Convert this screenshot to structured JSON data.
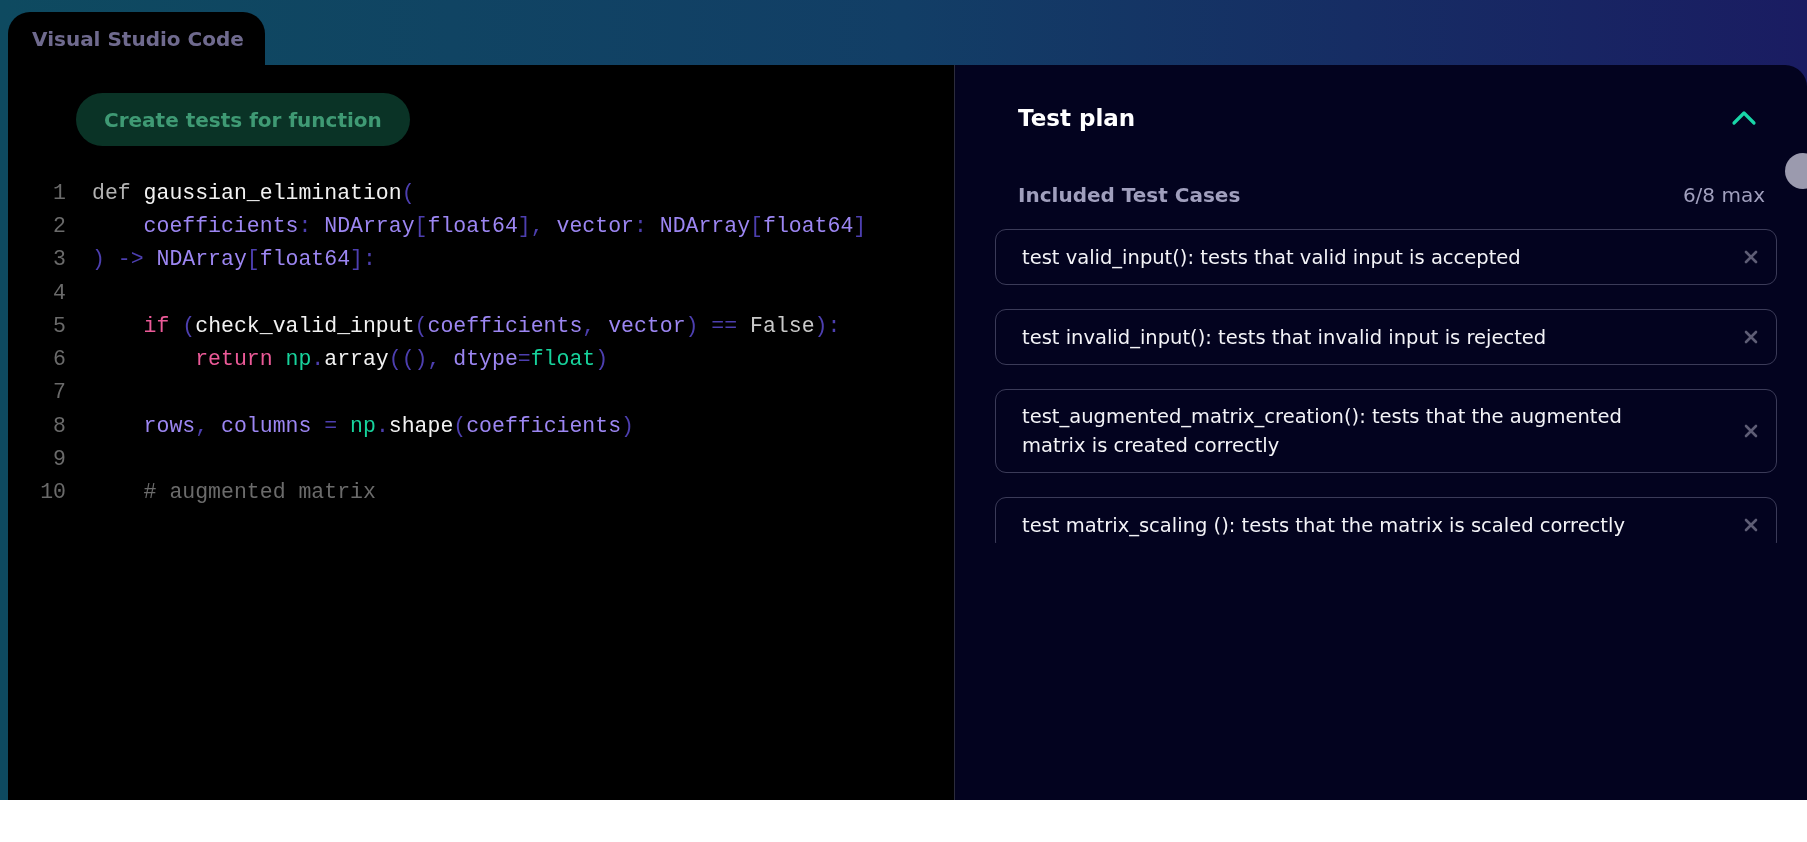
{
  "window": {
    "title": "Visual Studio Code"
  },
  "editor": {
    "action_button": "Create tests for function",
    "lines": [
      {
        "number": "1",
        "tokens": [
          {
            "text": "def ",
            "kind": "def"
          },
          {
            "text": "gaussian_elimination",
            "kind": "fn"
          },
          {
            "text": "(",
            "kind": "punct"
          }
        ]
      },
      {
        "number": "2",
        "tokens": [
          {
            "text": "    coefficients",
            "kind": "ident"
          },
          {
            "text": ": ",
            "kind": "punct"
          },
          {
            "text": "NDArray",
            "kind": "ident"
          },
          {
            "text": "[",
            "kind": "punct"
          },
          {
            "text": "float64",
            "kind": "ident"
          },
          {
            "text": "], ",
            "kind": "punct"
          },
          {
            "text": "vector",
            "kind": "ident"
          },
          {
            "text": ": ",
            "kind": "punct"
          },
          {
            "text": "NDArray",
            "kind": "ident"
          },
          {
            "text": "[",
            "kind": "punct"
          },
          {
            "text": "float64",
            "kind": "ident"
          },
          {
            "text": "]",
            "kind": "punct"
          }
        ]
      },
      {
        "number": "3",
        "tokens": [
          {
            "text": ") -> ",
            "kind": "punct"
          },
          {
            "text": "NDArray",
            "kind": "ident"
          },
          {
            "text": "[",
            "kind": "punct"
          },
          {
            "text": "float64",
            "kind": "ident"
          },
          {
            "text": "]:",
            "kind": "punct"
          }
        ]
      },
      {
        "number": "4"
      },
      {
        "number": "5",
        "tokens": [
          {
            "text": "    if ",
            "kind": "keyword"
          },
          {
            "text": "(",
            "kind": "punct"
          },
          {
            "text": "check_valid_input",
            "kind": "fn"
          },
          {
            "text": "(",
            "kind": "punct"
          },
          {
            "text": "coefficients",
            "kind": "ident"
          },
          {
            "text": ", ",
            "kind": "punct"
          },
          {
            "text": "vector",
            "kind": "ident"
          },
          {
            "text": ") == ",
            "kind": "punct"
          },
          {
            "text": "False",
            "kind": "const"
          },
          {
            "text": "):",
            "kind": "punct"
          }
        ]
      },
      {
        "number": "6",
        "tokens": [
          {
            "text": "        return ",
            "kind": "keyword"
          },
          {
            "text": "np",
            "kind": "builtin"
          },
          {
            "text": ".",
            "kind": "punct"
          },
          {
            "text": "array",
            "kind": "fn"
          },
          {
            "text": "((), ",
            "kind": "punct"
          },
          {
            "text": "dtype",
            "kind": "ident"
          },
          {
            "text": "=",
            "kind": "punct"
          },
          {
            "text": "float",
            "kind": "builtin"
          },
          {
            "text": ")",
            "kind": "punct"
          }
        ]
      },
      {
        "number": "7"
      },
      {
        "number": "8",
        "tokens": [
          {
            "text": "    rows",
            "kind": "ident"
          },
          {
            "text": ", ",
            "kind": "punct"
          },
          {
            "text": "columns",
            "kind": "ident"
          },
          {
            "text": " = ",
            "kind": "punct"
          },
          {
            "text": "np",
            "kind": "builtin"
          },
          {
            "text": ".",
            "kind": "punct"
          },
          {
            "text": "shape",
            "kind": "fn"
          },
          {
            "text": "(",
            "kind": "punct"
          },
          {
            "text": "coefficients",
            "kind": "ident"
          },
          {
            "text": ")",
            "kind": "punct"
          }
        ]
      },
      {
        "number": "9"
      },
      {
        "number": "10",
        "tokens": [
          {
            "text": "    # augmented matrix",
            "kind": "comment"
          }
        ]
      }
    ]
  },
  "test_plan": {
    "title": "Test plan",
    "expanded": true,
    "section_title": "Included Test Cases",
    "count": "6/8 max",
    "cases": [
      {
        "text": "test valid_input(): tests that valid input is accepted"
      },
      {
        "text": "test invalid_input(): tests that invalid input is rejected"
      },
      {
        "text": "test_augmented_matrix_creation(): tests that the augmented matrix is created correctly"
      },
      {
        "text": "test matrix_scaling (): tests that the matrix is scaled correctly"
      }
    ]
  }
}
